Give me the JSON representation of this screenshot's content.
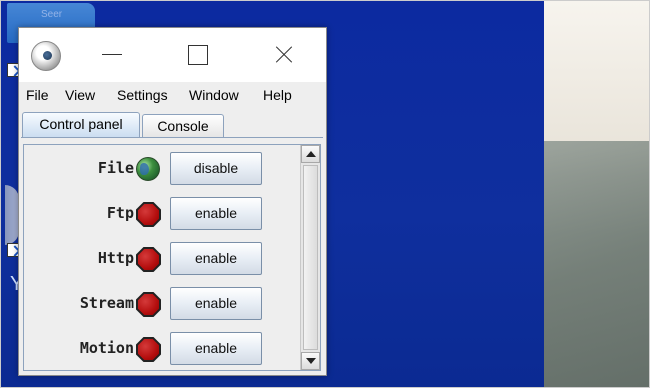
{
  "desktop": {
    "folder_label": "Seer",
    "partial_letter": "Y"
  },
  "window": {
    "menu": [
      "File",
      "View",
      "Settings",
      "Window",
      "Help"
    ],
    "tabs": [
      {
        "label": "Control panel",
        "active": true
      },
      {
        "label": "Console",
        "active": false
      }
    ],
    "rows": [
      {
        "label": "File",
        "status_icon": "globe-icon",
        "button": "disable"
      },
      {
        "label": "Ftp",
        "status_icon": "stop-icon",
        "button": "enable"
      },
      {
        "label": "Http",
        "status_icon": "stop-icon",
        "button": "enable"
      },
      {
        "label": "Stream",
        "status_icon": "stop-icon",
        "button": "enable"
      },
      {
        "label": "Motion",
        "status_icon": "stop-icon",
        "button": "enable"
      }
    ]
  },
  "colors": {
    "desktop_blue": "#0c2aa0",
    "stop_red": "#b40e0e",
    "globe_green": "#3d8f3f",
    "tab_border": "#8da2bd"
  }
}
